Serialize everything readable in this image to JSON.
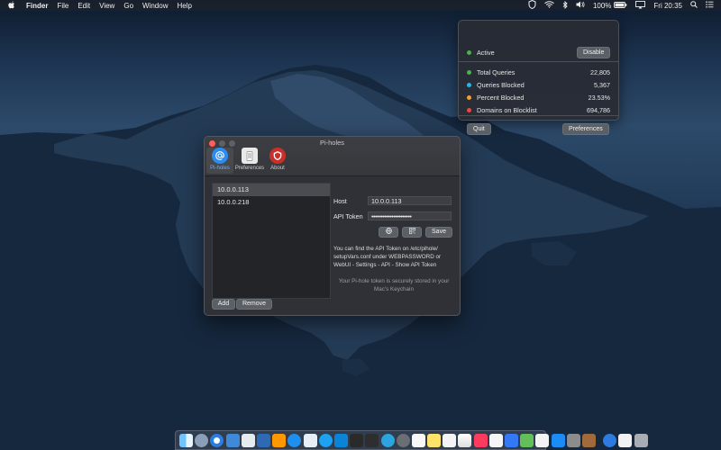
{
  "menubar": {
    "apple_icon": "apple-icon",
    "app": "Finder",
    "menus": [
      "File",
      "Edit",
      "View",
      "Go",
      "Window",
      "Help"
    ],
    "battery": "100%",
    "clock": "Fri 20:35"
  },
  "popover": {
    "status_label": "Active",
    "disable_label": "Disable",
    "stats": [
      {
        "label": "Total Queries",
        "value": "22,805",
        "color": "#4caf50"
      },
      {
        "label": "Queries Blocked",
        "value": "5,367",
        "color": "#2bb3e6"
      },
      {
        "label": "Percent Blocked",
        "value": "23.53%",
        "color": "#f0a030"
      },
      {
        "label": "Domains on Blocklist",
        "value": "694,786",
        "color": "#e84b3c"
      }
    ],
    "status_color": "#4caf50",
    "quit_label": "Quit",
    "preferences_label": "Preferences"
  },
  "window": {
    "title": "Pi-holes",
    "toolbar": [
      {
        "label": "Pi-holes",
        "icon": "at-sign-icon"
      },
      {
        "label": "Preferences",
        "icon": "phone-icon"
      },
      {
        "label": "About",
        "icon": "pihole-logo-icon"
      }
    ],
    "hosts": [
      "10.0.0.113",
      "10.0.0.218"
    ],
    "add_label": "Add",
    "remove_label": "Remove",
    "host_label": "Host",
    "host_value": "10.0.0.113",
    "token_label": "API Token",
    "token_value": "••••••••••••••••••••••",
    "save_label": "Save",
    "help_text": "You can find the API Token on /etc/pihole/ setupVars.conf under WEBPASSWORD or WebUI - Settings - API - Show API Token",
    "secure_text": "Your Pi-hole token is securely stored in your Mac's Keychain"
  }
}
